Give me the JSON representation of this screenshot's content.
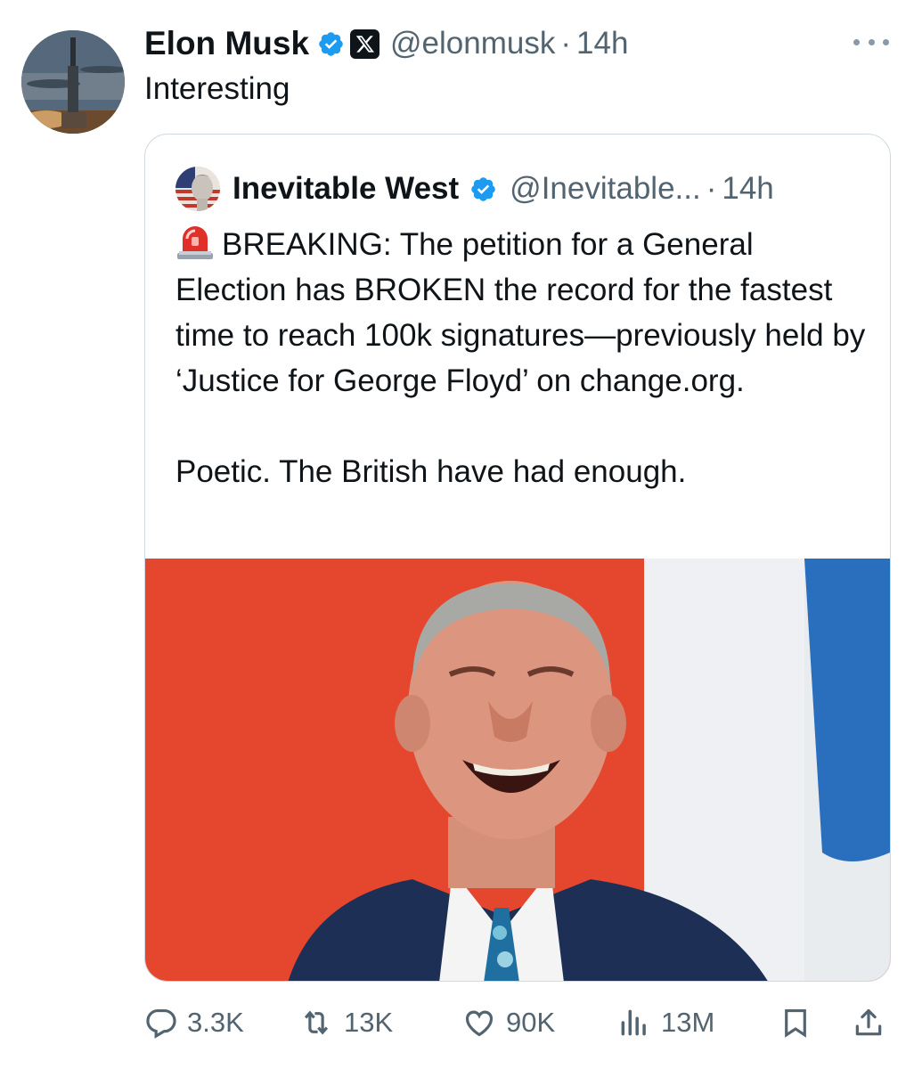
{
  "tweet": {
    "author_name": "Elon Musk",
    "handle": "@elonmusk",
    "separator": "·",
    "time": "14h",
    "text": "Interesting"
  },
  "quote": {
    "author_name": "Inevitable West",
    "handle": "@Inevitable...",
    "separator": "·",
    "time": "14h",
    "paragraphs": [
      "BREAKING: The petition for a General Election has BROKEN the record for the fastest time to reach 100k signatures—previously held by ‘Justice for George Floyd’ on change.org.",
      "Poetic. The British have had enough."
    ]
  },
  "actions": {
    "replies": "3.3K",
    "reposts": "13K",
    "likes": "90K",
    "views": "13M"
  },
  "colors": {
    "verified_blue": "#1d9bf0",
    "text_primary": "#0f1419",
    "text_secondary": "#536471",
    "border": "#cfd9de"
  },
  "icons": [
    "verified-badge-icon",
    "x-logo-icon",
    "more-options-icon",
    "siren-emoji-icon",
    "reply-icon",
    "repost-icon",
    "like-icon",
    "views-icon",
    "bookmark-icon",
    "share-icon"
  ]
}
